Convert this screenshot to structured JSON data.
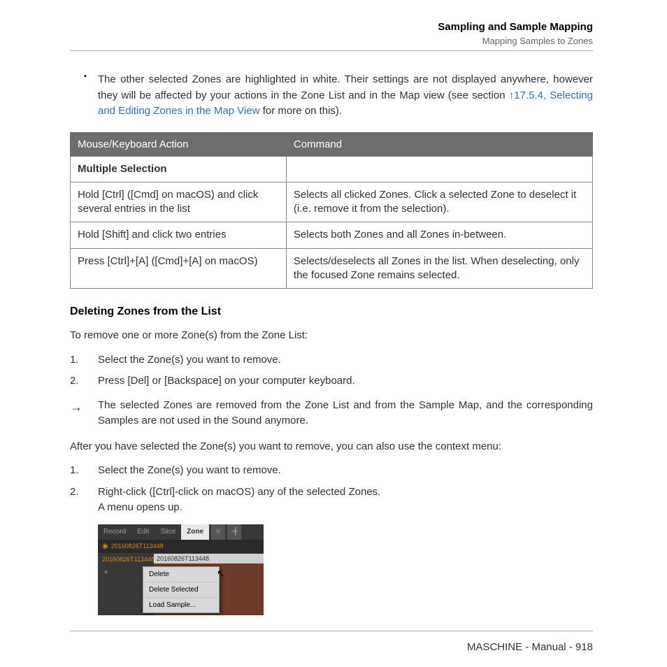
{
  "header": {
    "title": "Sampling and Sample Mapping",
    "subtitle": "Mapping Samples to Zones"
  },
  "bullet": {
    "text_before": "The other selected Zones are highlighted in white. Their settings are not displayed anywhere, however they will be affected by your actions in the Zone List and in the Map view (see section ",
    "link": "↑17.5.4, Selecting and Editing Zones in the Map View",
    "text_after": " for more on this)."
  },
  "table": {
    "headers": [
      "Mouse/Keyboard Action",
      "Command"
    ],
    "subhead": "Multiple Selection",
    "rows": [
      [
        "Hold [Ctrl] ([Cmd] on macOS) and click several entries in the list",
        "Selects all clicked Zones. Click a selected Zone to deselect it (i.e. remove it from the selection)."
      ],
      [
        "Hold [Shift] and click two entries",
        "Selects both Zones and all Zones in-between."
      ],
      [
        "Press [Ctrl]+[A] ([Cmd]+[A] on macOS)",
        "Selects/deselects all Zones in the list. When deselecting, only the focused Zone remains selected."
      ]
    ]
  },
  "section_heading": "Deleting Zones from the List",
  "intro": "To remove one or more Zone(s) from the Zone List:",
  "steps1": [
    "Select the Zone(s) you want to remove.",
    "Press [Del] or [Backspace] on your computer keyboard."
  ],
  "result": "The selected Zones are removed from the Zone List and from the Sample Map, and the corresponding Samples are not used in the Sound anymore.",
  "after": "After you have selected the Zone(s) you want to remove, you can also use the context menu:",
  "steps2": [
    "Select the Zone(s) you want to remove.",
    "Right-click ([Ctrl]-click on macOS) any of the selected Zones.\nA menu opens up."
  ],
  "screenshot": {
    "tabs": [
      "Record",
      "Edit",
      "Slice",
      "Zone"
    ],
    "item1": "20160826T113448",
    "item2": "20160826T113448",
    "map_label": "20160826T113448",
    "menu": [
      "Delete",
      "Delete Selected",
      "Load Sample..."
    ]
  },
  "footer": "MASCHINE - Manual - 918"
}
